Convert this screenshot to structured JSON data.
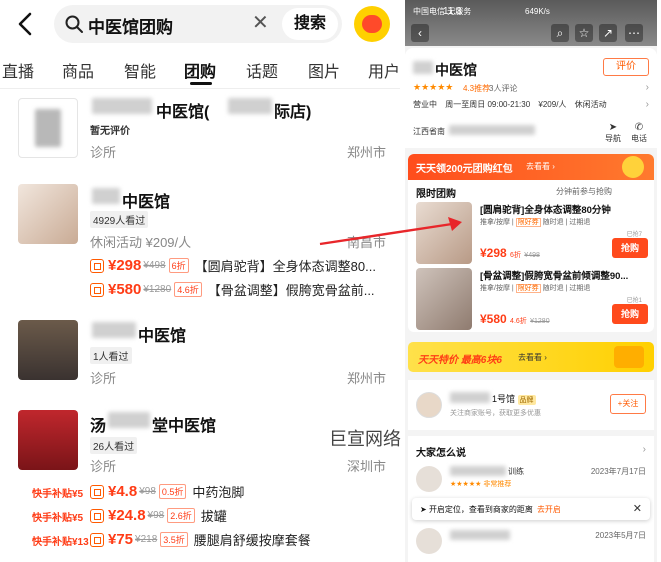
{
  "left": {
    "search": {
      "query": "中医馆团购",
      "clear_icon": "close-icon",
      "button": "搜索"
    },
    "tabs": [
      "直播",
      "商品",
      "智能",
      "团购",
      "话题",
      "图片",
      "用户"
    ],
    "active_tab": "团购",
    "items": [
      {
        "name_suffix": "中医馆(",
        "name_tail": "际店)",
        "badge": "暂无评价",
        "category": "诊所",
        "city": "郑州市",
        "deals": []
      },
      {
        "name_suffix": "中医馆",
        "badge": "4929人看过",
        "category": "休闲活动  ¥209/人",
        "city": "南昌市",
        "deals": [
          {
            "price": "¥298",
            "orig": "¥498",
            "disc": "6折",
            "title": "【圆肩驼背】全身体态调整80..."
          },
          {
            "price": "¥580",
            "orig": "¥1280",
            "disc": "4.6折",
            "title": "【骨盆调整】假胯宽骨盆前..."
          }
        ]
      },
      {
        "name_suffix": "中医馆",
        "badge": "1人看过",
        "category": "诊所",
        "city": "郑州市",
        "deals": []
      },
      {
        "name_prefix": "汤",
        "name_suffix": "堂中医馆",
        "badge": "26人看过",
        "category": "诊所",
        "city": "深圳市",
        "deals": [
          {
            "subsidy": "快手补贴¥5",
            "price": "¥4.8",
            "orig": "¥98",
            "disc": "0.5折",
            "title": "中药泡脚"
          },
          {
            "subsidy": "快手补贴¥5",
            "price": "¥24.8",
            "orig": "¥98",
            "disc": "2.6折",
            "title": "拔罐"
          },
          {
            "subsidy": "快手补贴¥13",
            "price": "¥75",
            "orig": "¥218",
            "disc": "3.5折",
            "title": "腰腿肩舒缓按摩套餐"
          }
        ]
      }
    ]
  },
  "watermark": "巨宣网络",
  "right": {
    "status_left": "中国电信 无服务",
    "time": "11:3",
    "status_right": "649K/s",
    "shop_title": "中医馆",
    "eval_button": "评价",
    "rating": "4.3推荐",
    "reviews": "3人评论",
    "hours_label": "营业中",
    "hours": "周一至周日 09:00-21:30",
    "per_person": "¥209/人",
    "activity": "休闲活动",
    "address": "江西省南",
    "nav_label": "导航",
    "phone_label": "电话",
    "group_banner": "天天领200元团购红包",
    "group_banner_more": "去看看 ›",
    "limited_label": "限时团购",
    "limited_note": "分钟前参与抢购",
    "deals": [
      {
        "title": "[圆肩驼背]全身体态调整80分钟",
        "tags": [
          "推拿/按摩",
          "限好券",
          "随时退",
          "过期退"
        ],
        "price": "¥298",
        "disc": "6折",
        "orig": "¥498",
        "sold": "已抢7",
        "buy": "抢购"
      },
      {
        "title": "[骨盆调整]假胯宽骨盆前倾调整90...",
        "tags": [
          "推拿/按摩",
          "限好券",
          "随时退",
          "过期退"
        ],
        "price": "¥580",
        "disc": "4.6折",
        "orig": "¥1280",
        "sold": "已抢1",
        "buy": "抢购"
      }
    ],
    "special_title": "天天特价 最高6块6",
    "special_more": "去看看 ›",
    "shop_row_name": "1号馆",
    "shop_row_badge": "品牌",
    "shop_row_sub": "关注商家账号，获取更多优惠",
    "follow": "+关注",
    "reviews_header": "大家怎么说",
    "review_items": [
      {
        "name": "训练",
        "stars": "★★★★★ 非常推荐",
        "date": "2023年7月17日"
      },
      {
        "name": "",
        "stars": "",
        "date": "2023年5月7日"
      }
    ],
    "toast": "开启定位，查看到商家的距离",
    "toast_action": "去开启"
  }
}
